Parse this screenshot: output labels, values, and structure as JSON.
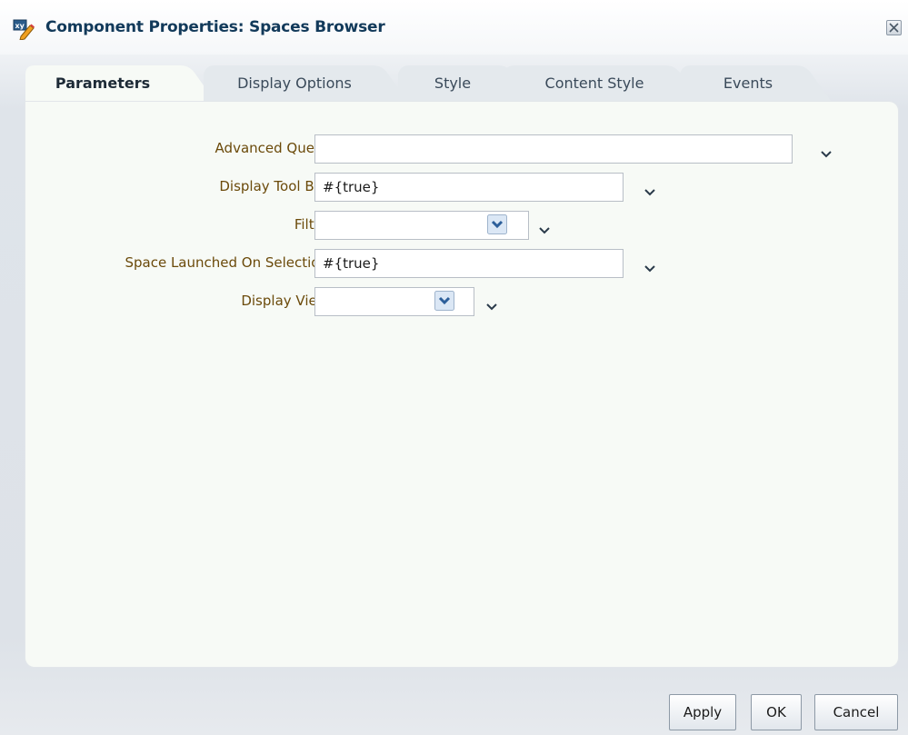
{
  "dialog": {
    "title": "Component Properties: Spaces Browser",
    "title_icon": "edit-properties-icon",
    "close_icon": "close-icon"
  },
  "tabs": [
    {
      "label": "Parameters",
      "active": true
    },
    {
      "label": "Display Options",
      "active": false
    },
    {
      "label": "Style",
      "active": false
    },
    {
      "label": "Content Style",
      "active": false
    },
    {
      "label": "Events",
      "active": false
    }
  ],
  "parameters": {
    "advanced_query": {
      "label": "Advanced Query",
      "value": ""
    },
    "display_tool_bar": {
      "label": "Display Tool Bar",
      "value": "#{true}"
    },
    "filter": {
      "label": "Filter",
      "value": ""
    },
    "space_launched_on_selection": {
      "label": "Space Launched On Selection",
      "value": "#{true}"
    },
    "display_view": {
      "label": "Display View",
      "value": ""
    }
  },
  "footer": {
    "apply_label": "Apply",
    "ok_label": "OK",
    "cancel_label": "Cancel"
  },
  "colors": {
    "title_text": "#123a5a",
    "label_text": "#6b4a0a",
    "panel_bg": "#f7faf6"
  }
}
